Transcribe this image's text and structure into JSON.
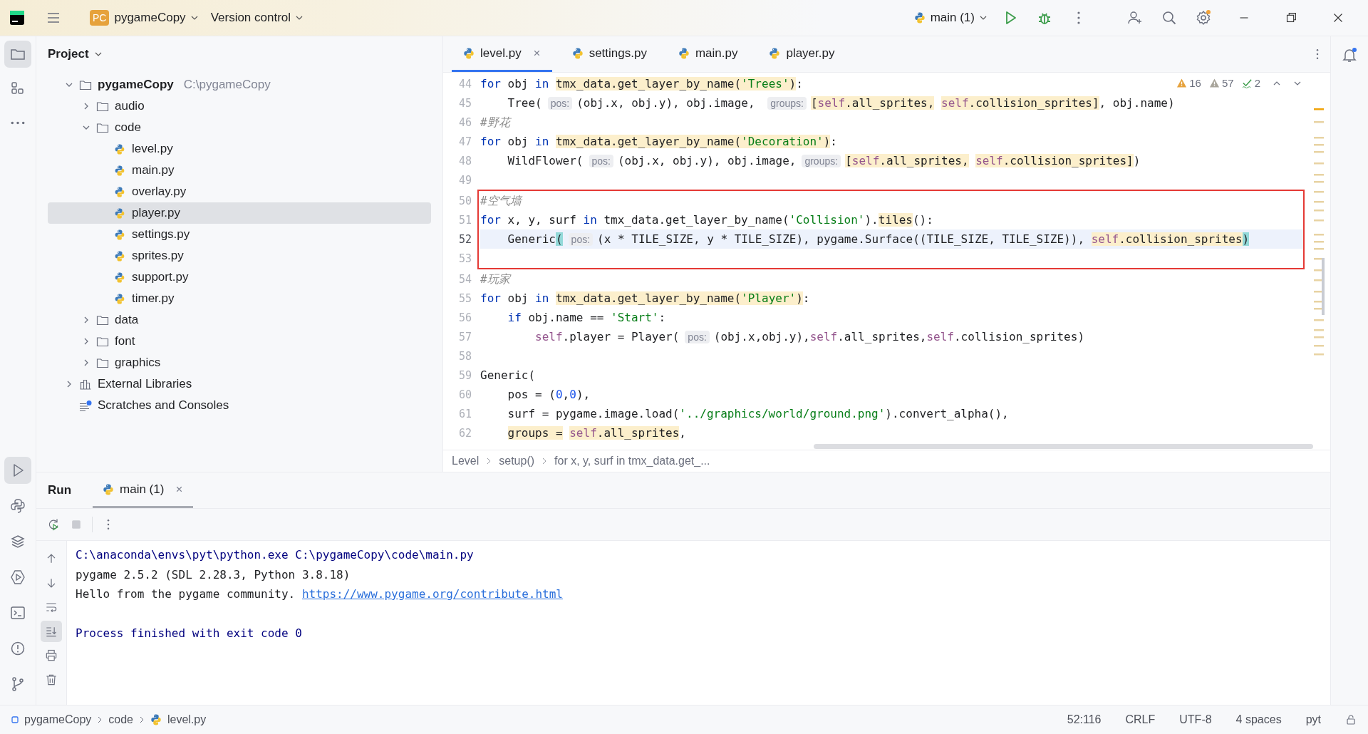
{
  "title_bar": {
    "project_badge": "PC",
    "project": "pygameCopy",
    "vcs": "Version control",
    "run_config": "main (1)"
  },
  "tool_strip": {
    "top": [
      {
        "kind": "folder",
        "selected": true
      },
      {
        "kind": "structure",
        "selected": false
      },
      {
        "kind": "more",
        "selected": false
      }
    ],
    "bottom": [
      {
        "kind": "run",
        "selected": true
      },
      {
        "kind": "python",
        "selected": false
      },
      {
        "kind": "layers",
        "selected": false
      },
      {
        "kind": "services",
        "selected": false
      },
      {
        "kind": "terminal",
        "selected": false
      },
      {
        "kind": "problems",
        "selected": false
      },
      {
        "kind": "git",
        "selected": false
      }
    ]
  },
  "project_panel": {
    "title": "Project",
    "tree": [
      {
        "label": "pygameCopy",
        "path": "C:\\pygameCopy",
        "kind": "root",
        "expanded": true,
        "selected": false,
        "children": [
          {
            "label": "audio",
            "kind": "folder",
            "expanded": false,
            "selected": false
          },
          {
            "label": "code",
            "kind": "folder",
            "expanded": true,
            "selected": false,
            "children": [
              {
                "label": "level.py",
                "kind": "file",
                "selected": false
              },
              {
                "label": "main.py",
                "kind": "file",
                "selected": false
              },
              {
                "label": "overlay.py",
                "kind": "file",
                "selected": false
              },
              {
                "label": "player.py",
                "kind": "file",
                "selected": true
              },
              {
                "label": "settings.py",
                "kind": "file",
                "selected": false
              },
              {
                "label": "sprites.py",
                "kind": "file",
                "selected": false
              },
              {
                "label": "support.py",
                "kind": "file",
                "selected": false
              },
              {
                "label": "timer.py",
                "kind": "file",
                "selected": false
              }
            ]
          },
          {
            "label": "data",
            "kind": "folder",
            "expanded": false,
            "selected": false
          },
          {
            "label": "font",
            "kind": "folder",
            "expanded": false,
            "selected": false
          },
          {
            "label": "graphics",
            "kind": "folder",
            "expanded": false,
            "selected": false
          }
        ]
      },
      {
        "label": "External Libraries",
        "kind": "libs",
        "expanded": false,
        "selected": false
      },
      {
        "label": "Scratches and Consoles",
        "kind": "scratch",
        "selected": false
      }
    ]
  },
  "editor": {
    "tabs": [
      {
        "label": "level.py",
        "selected": true
      },
      {
        "label": "settings.py",
        "selected": false
      },
      {
        "label": "main.py",
        "selected": false
      },
      {
        "label": "player.py",
        "selected": false
      }
    ],
    "inspections": {
      "warnings": "16",
      "weak_warnings": "57",
      "typos": "2"
    },
    "blocks": [
      {
        "boxed": false,
        "lines": [
          {
            "number": "44",
            "current": false,
            "tokens": [
              {
                "text": "for ",
                "kind": "kw"
              },
              {
                "text": "obj ",
                "kind": "plain"
              },
              {
                "text": "in ",
                "kind": "kw"
              },
              {
                "text": "tmx_data.get_layer_by_name(",
                "kind": "hl"
              },
              {
                "text": "'Trees'",
                "kind": "hl-str"
              },
              {
                "text": ")",
                "kind": "hl"
              },
              {
                "text": ":",
                "kind": "plain"
              }
            ]
          },
          {
            "number": "45",
            "current": false,
            "tokens": [
              {
                "text": "    Tree(",
                "kind": "plain"
              },
              {
                "text": "pos:",
                "kind": "hint"
              },
              {
                "text": "(obj.x, obj.y), obj.image, ",
                "kind": "plain"
              },
              {
                "text": "groups:",
                "kind": "hint"
              },
              {
                "text": "[",
                "kind": "hl"
              },
              {
                "text": "self",
                "kind": "hl-self"
              },
              {
                "text": ".all_sprites, ",
                "kind": "hl"
              },
              {
                "text": "self",
                "kind": "hl-self"
              },
              {
                "text": ".collision_sprites]",
                "kind": "hl"
              },
              {
                "text": ", obj.name)",
                "kind": "plain"
              }
            ]
          },
          {
            "number": "46",
            "current": false,
            "tokens": [
              {
                "text": "#野花",
                "kind": "cmt"
              }
            ]
          },
          {
            "number": "47",
            "current": false,
            "tokens": [
              {
                "text": "for ",
                "kind": "kw"
              },
              {
                "text": "obj ",
                "kind": "plain"
              },
              {
                "text": "in ",
                "kind": "kw"
              },
              {
                "text": "tmx_data.get_layer_by_name(",
                "kind": "hl"
              },
              {
                "text": "'Decoration'",
                "kind": "hl-str"
              },
              {
                "text": ")",
                "kind": "hl"
              },
              {
                "text": ":",
                "kind": "plain"
              }
            ]
          },
          {
            "number": "48",
            "current": false,
            "tokens": [
              {
                "text": "    WildFlower(",
                "kind": "plain"
              },
              {
                "text": "pos:",
                "kind": "hint"
              },
              {
                "text": "(obj.x, obj.y), obj.image,",
                "kind": "plain"
              },
              {
                "text": "groups:",
                "kind": "hint"
              },
              {
                "text": "[",
                "kind": "hl"
              },
              {
                "text": "self",
                "kind": "hl-self"
              },
              {
                "text": ".all_sprites, ",
                "kind": "hl"
              },
              {
                "text": "self",
                "kind": "hl-self"
              },
              {
                "text": ".collision_sprites]",
                "kind": "hl"
              },
              {
                "text": ")",
                "kind": "plain"
              }
            ]
          },
          {
            "number": "49",
            "current": false
          }
        ]
      },
      {
        "boxed": true,
        "lines": [
          {
            "number": "50",
            "current": false,
            "tokens": [
              {
                "text": "#空气墙",
                "kind": "cmt"
              }
            ]
          },
          {
            "number": "51",
            "current": false,
            "tokens": [
              {
                "text": "for ",
                "kind": "kw"
              },
              {
                "text": "x, y, surf ",
                "kind": "plain"
              },
              {
                "text": "in ",
                "kind": "kw"
              },
              {
                "text": "tmx_data.get_layer_by_name(",
                "kind": "plain"
              },
              {
                "text": "'Collision'",
                "kind": "str"
              },
              {
                "text": ").",
                "kind": "plain"
              },
              {
                "text": "tiles",
                "kind": "hl"
              },
              {
                "text": "():",
                "kind": "plain"
              }
            ]
          },
          {
            "number": "52",
            "current": true,
            "tokens": [
              {
                "text": "    Generic",
                "kind": "plain"
              },
              {
                "text": "(",
                "kind": "brace"
              },
              {
                "text": "pos:",
                "kind": "hint"
              },
              {
                "text": "(x * TILE_SIZE, y * TILE_SIZE), pygame.Surface((TILE_SIZE, TILE_SIZE)), ",
                "kind": "plain"
              },
              {
                "text": "self",
                "kind": "hl-self"
              },
              {
                "text": ".collision_sprites",
                "kind": "hl"
              },
              {
                "text": ")",
                "kind": "brace"
              }
            ]
          },
          {
            "number": "53",
            "current": false
          }
        ]
      },
      {
        "boxed": false,
        "lines": [
          {
            "number": "54",
            "current": false,
            "tokens": [
              {
                "text": "#玩家",
                "kind": "cmt"
              }
            ]
          },
          {
            "number": "55",
            "current": false,
            "tokens": [
              {
                "text": "for ",
                "kind": "kw"
              },
              {
                "text": "obj ",
                "kind": "plain"
              },
              {
                "text": "in ",
                "kind": "kw"
              },
              {
                "text": "tmx_data.get_layer_by_name(",
                "kind": "hl"
              },
              {
                "text": "'Player'",
                "kind": "hl-str"
              },
              {
                "text": ")",
                "kind": "hl"
              },
              {
                "text": ":",
                "kind": "plain"
              }
            ]
          },
          {
            "number": "56",
            "current": false,
            "tokens": [
              {
                "text": "    if ",
                "kind": "kw"
              },
              {
                "text": "obj.name == ",
                "kind": "plain"
              },
              {
                "text": "'Start'",
                "kind": "str"
              },
              {
                "text": ":",
                "kind": "plain"
              }
            ]
          },
          {
            "number": "57",
            "current": false,
            "tokens": [
              {
                "text": "        self",
                "kind": "self"
              },
              {
                "text": ".player = Player(",
                "kind": "plain"
              },
              {
                "text": "pos:",
                "kind": "hint"
              },
              {
                "text": "(obj.x,obj.y),",
                "kind": "plain"
              },
              {
                "text": "self",
                "kind": "self"
              },
              {
                "text": ".all_sprites,",
                "kind": "plain"
              },
              {
                "text": "self",
                "kind": "self"
              },
              {
                "text": ".collision_sprites)",
                "kind": "plain"
              }
            ]
          },
          {
            "number": "58",
            "current": false
          },
          {
            "number": "59",
            "current": false,
            "tokens": [
              {
                "text": "Generic(",
                "kind": "plain"
              }
            ]
          },
          {
            "number": "60",
            "current": false,
            "tokens": [
              {
                "text": "    pos = (",
                "kind": "plain"
              },
              {
                "text": "0",
                "kind": "num"
              },
              {
                "text": ",",
                "kind": "plain"
              },
              {
                "text": "0",
                "kind": "num"
              },
              {
                "text": "),",
                "kind": "plain"
              }
            ]
          },
          {
            "number": "61",
            "current": false,
            "tokens": [
              {
                "text": "    surf = pygame.image.load(",
                "kind": "plain"
              },
              {
                "text": "'../graphics/world/ground.png'",
                "kind": "str"
              },
              {
                "text": ").convert_alpha(),",
                "kind": "plain"
              }
            ]
          },
          {
            "number": "62",
            "current": false,
            "tokens": [
              {
                "text": "    groups = ",
                "kind": "hl"
              },
              {
                "text": "self",
                "kind": "hl-self"
              },
              {
                "text": ".all_sprites",
                "kind": "hl"
              },
              {
                "text": ",",
                "kind": "plain"
              }
            ]
          }
        ]
      }
    ],
    "breadcrumbs": [
      "Level",
      "setup()",
      "for x, y, surf in tmx_data.get_..."
    ]
  },
  "run_panel": {
    "title": "Run",
    "tab": "main (1)",
    "gutter": [
      {
        "kind": "up",
        "selected": false
      },
      {
        "kind": "down",
        "selected": false
      },
      {
        "kind": "wrap",
        "selected": false
      },
      {
        "kind": "scroll-end",
        "selected": true
      },
      {
        "kind": "print",
        "selected": false
      },
      {
        "kind": "trash",
        "selected": false
      }
    ],
    "console": [
      {
        "kind": "system",
        "text": "C:\\anaconda\\envs\\pyt\\python.exe C:\\pygameCopy\\code\\main.py"
      },
      {
        "kind": "output",
        "text": "pygame 2.5.2 (SDL 2.28.3, Python 3.8.18)"
      },
      {
        "kind": "output",
        "text": "Hello from the pygame community. ",
        "link": "https://www.pygame.org/contribute.html"
      },
      {
        "kind": "exit",
        "text": "Process finished with exit code 0"
      }
    ]
  },
  "status_bar": {
    "path": [
      "pygameCopy",
      "code",
      "level.py"
    ],
    "items": [
      "52:116",
      "CRLF",
      "UTF-8",
      "4 spaces",
      "pyt"
    ]
  }
}
